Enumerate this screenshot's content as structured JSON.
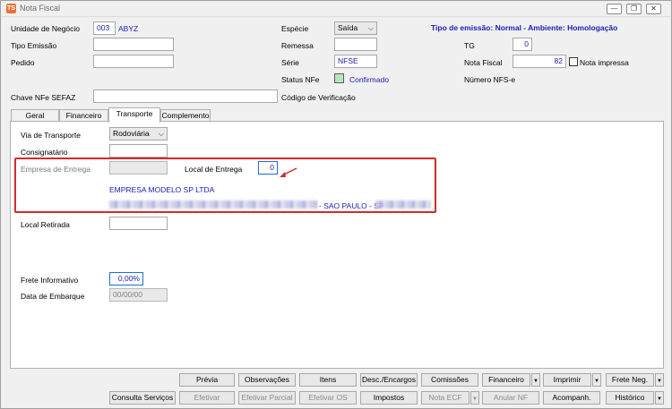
{
  "window": {
    "title": "Nota Fiscal",
    "app_icon": "ts-logo-icon",
    "controls": {
      "minimize": "—",
      "restore": "❐",
      "close": "✕"
    }
  },
  "header": {
    "unidade_label": "Unidade de Negócio",
    "unidade_code": "003",
    "unidade_name": "ABYZ",
    "tipo_emissao_label": "Tipo Emissão",
    "tipo_emissao_value": "",
    "pedido_label": "Pedido",
    "pedido_value": "",
    "especie_label": "Espécie",
    "especie_value": "Saída",
    "remessa_label": "Remessa",
    "remessa_value": "",
    "serie_label": "Série",
    "serie_value": "NFSE",
    "status_nfe_label": "Status NFe",
    "status_nfe_value": "Confirmado",
    "tipo_banner": "Tipo de emissão: Normal - Ambiente: Homologação",
    "tg_label": "TG",
    "tg_value": "0",
    "nota_fiscal_label": "Nota Fiscal",
    "nota_fiscal_value": "82",
    "nota_impressa_label": "Nota impressa",
    "numero_nfse_label": "Número NFS-e",
    "chave_label": "Chave NFe SEFAZ",
    "chave_value": "",
    "codigo_verificacao_label": "Código de Verificação"
  },
  "tabs": [
    {
      "label": "Geral"
    },
    {
      "label": "Financeiro"
    },
    {
      "label": "Transporte"
    },
    {
      "label": "Complemento"
    }
  ],
  "transporte": {
    "via_label": "Via de Transporte",
    "via_value": "Rodoviária",
    "consignatario_label": "Consignatário",
    "consignatario_value": "",
    "empresa_entrega_label": "Empresa de Entrega",
    "local_entrega_label": "Local de Entrega",
    "local_entrega_value": "0",
    "empresa_nome": "EMPRESA MODELO SP LTDA",
    "endereco_suffix": "- SAO PAULO - SP",
    "local_retirada_label": "Local Retirada",
    "local_retirada_value": "",
    "frete_label": "Frete Informativo",
    "frete_value": "0,00%",
    "embarque_label": "Data de Embarque",
    "embarque_value": "00/00/00"
  },
  "buttons_row1": {
    "previa": "Prévia",
    "observacoes": "Observações",
    "itens": "Itens",
    "desc_encargos": "Desc./Encargos",
    "comissoes": "Comissões",
    "financeiro": "Financeiro",
    "imprimir": "Imprimir",
    "frete_neg": "Frete Neg."
  },
  "buttons_row2": {
    "consulta_servicos": "Consulta Serviços",
    "efetivar": "Efetivar",
    "efetivar_parcial": "Efetivar Parcial",
    "efetivar_os": "Efetivar OS",
    "impostos": "Impostos",
    "nota_ecf": "Nota ECF",
    "anular_nf": "Anular NF",
    "acompanh": "Acompanh.",
    "historico": "Histórico"
  },
  "colors": {
    "highlight_border": "#d42a2a",
    "value_text": "#1a1ab3",
    "status_ok": "#b8e6b8"
  }
}
